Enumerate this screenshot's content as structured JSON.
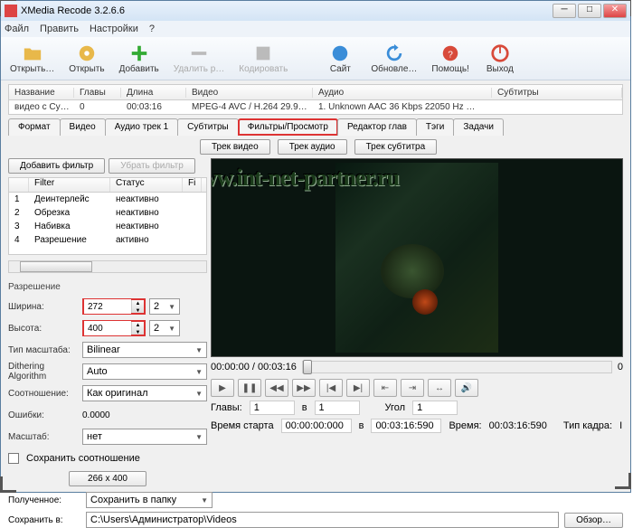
{
  "window": {
    "title": "XMedia Recode 3.2.6.6"
  },
  "menu": [
    "Файл",
    "Править",
    "Настройки",
    "?"
  ],
  "toolbar": [
    {
      "label": "Открыть…",
      "icon": "folder"
    },
    {
      "label": "Открыть",
      "icon": "disc"
    },
    {
      "label": "Добавить",
      "icon": "plus"
    },
    {
      "label": "Удалить р…",
      "icon": "minus",
      "dis": true
    },
    {
      "label": "Кодировать",
      "icon": "encode",
      "dis": true
    },
    {
      "label": "Сайт",
      "icon": "globe"
    },
    {
      "label": "Обновле…",
      "icon": "refresh"
    },
    {
      "label": "Помощь!",
      "icon": "help"
    },
    {
      "label": "Выход",
      "icon": "power"
    }
  ],
  "listhead": {
    "name": "Название",
    "chap": "Главы",
    "dur": "Длина",
    "vid": "Видео",
    "aud": "Аудио",
    "sub": "Субтитры"
  },
  "listrow": {
    "name": "видео с Cy…",
    "chap": "0",
    "dur": "00:03:16",
    "vid": "MPEG-4 AVC / H.264 29.9…",
    "aud": "1. Unknown AAC 36 Kbps 22050 Hz …",
    "sub": ""
  },
  "tabs": [
    "Формат",
    "Видео",
    "Аудио трек 1",
    "Субтитры",
    "Фильтры/Просмотр",
    "Редактор глав",
    "Тэги",
    "Задачи"
  ],
  "trackbtns": [
    "Трек видео",
    "Трек аудио",
    "Трек субтитра"
  ],
  "filterbtns": {
    "add": "Добавить фильтр",
    "remove": "Убрать фильтр"
  },
  "fthead": {
    "n": "",
    "filter": "Filter",
    "status": "Статус",
    "f": "Fi"
  },
  "filters": [
    {
      "n": "1",
      "name": "Деинтерлейс",
      "status": "неактивно"
    },
    {
      "n": "2",
      "name": "Обрезка",
      "status": "неактивно"
    },
    {
      "n": "3",
      "name": "Набивка",
      "status": "неактивно"
    },
    {
      "n": "4",
      "name": "Разрешение",
      "status": "активно"
    }
  ],
  "res": {
    "section": "Разрешение",
    "width_lbl": "Ширина:",
    "width": "272",
    "width_step": "2",
    "height_lbl": "Высота:",
    "height": "400",
    "height_step": "2",
    "scale_lbl": "Тип масштаба:",
    "scale": "Bilinear",
    "dither_lbl": "Dithering Algorithm",
    "dither": "Auto",
    "ratio_lbl": "Соотношение:",
    "ratio": "Как оригинал",
    "error_lbl": "Ошибки:",
    "error": "0.0000",
    "zoom_lbl": "Масштаб:",
    "zoom": "нет",
    "keep_lbl": "Сохранить соотношение",
    "dim_btn": "266 x 400"
  },
  "time": {
    "elapsed": "00:00:00 / 00:03:16",
    "zero": "0"
  },
  "info": {
    "chapters_lbl": "Главы:",
    "chapters": "1",
    "to": "в",
    "chapters2": "1",
    "angle_lbl": "Угол",
    "angle": "1",
    "start_lbl": "Время старта",
    "start": "00:00:00:000",
    "end": "00:03:16:590",
    "dur_lbl": "Время:",
    "dur": "00:03:16:590",
    "frame_lbl": "Тип кадра:",
    "frame": "I"
  },
  "bottom": {
    "dest_lbl": "Полученное:",
    "dest": "Сохранить в папку",
    "save_lbl": "Сохранить в:",
    "path": "C:\\Users\\Администратор\\Videos",
    "browse": "Обзор…"
  },
  "watermark": "www.int-net-partner.ru"
}
